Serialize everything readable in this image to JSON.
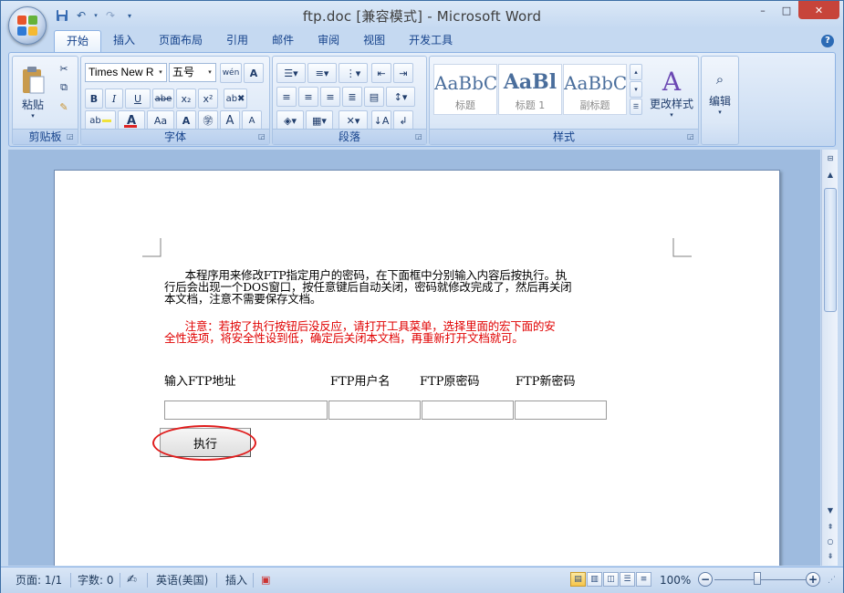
{
  "window": {
    "title": "ftp.doc [兼容模式] - Microsoft Word",
    "controls": {
      "minimize": "–",
      "maximize": "□",
      "close": "✕"
    }
  },
  "quick_access": {
    "save_icon": "save-icon",
    "undo_icon": "undo-icon",
    "redo_icon": "redo-icon"
  },
  "tabs": [
    "开始",
    "插入",
    "页面布局",
    "引用",
    "邮件",
    "审阅",
    "视图",
    "开发工具"
  ],
  "ribbon": {
    "clipboard": {
      "label": "剪贴板",
      "paste": "粘贴"
    },
    "font": {
      "label": "字体",
      "font_name": "Times New R",
      "font_size": "五号",
      "bold": "B",
      "italic": "I",
      "underline": "U",
      "strike": "abe",
      "subscript": "x₂",
      "superscript": "x²",
      "grow": "A",
      "shrink": "A",
      "case": "Aa",
      "clear": "A",
      "char_border": "A"
    },
    "paragraph": {
      "label": "段落"
    },
    "styles": {
      "label": "样式",
      "items": [
        {
          "sample": "AaBbC",
          "name": "标题"
        },
        {
          "sample": "AaBl",
          "name": "标题 1"
        },
        {
          "sample": "AaBbC",
          "name": "副标题"
        }
      ],
      "change_styles": "更改样式"
    },
    "editing": {
      "label": "编辑"
    }
  },
  "document": {
    "paragraph1_lines": [
      "      本程序用来修改FTP指定用户的密码，在下面框中分别输入内容后按执行。执",
      "行后会出现一个DOS窗口，按任意键后自动关闭，密码就修改完成了，然后再关闭",
      "本文档，注意不需要保存文档。"
    ],
    "paragraph2_lines": [
      "      注意：若按了执行按钮后没反应，请打开工具菜单，选择里面的宏下面的安",
      "全性选项，将安全性设到低，确定后关闭本文档，再重新打开文档就可。"
    ],
    "note_color": "#e00000",
    "labels": {
      "ftp_address": "输入FTP地址",
      "ftp_user": "FTP用户名",
      "old_password": "FTP原密码",
      "new_password": "FTP新密码"
    },
    "inputs": {
      "ftp_address": "",
      "ftp_user": "",
      "old_password": "",
      "new_password": ""
    },
    "execute_button": "执行"
  },
  "status_bar": {
    "page": "页面: 1/1",
    "word_count": "字数: 0",
    "language": "英语(美国)",
    "mode": "插入",
    "zoom": "100%",
    "zoom_level_percent": 100
  }
}
